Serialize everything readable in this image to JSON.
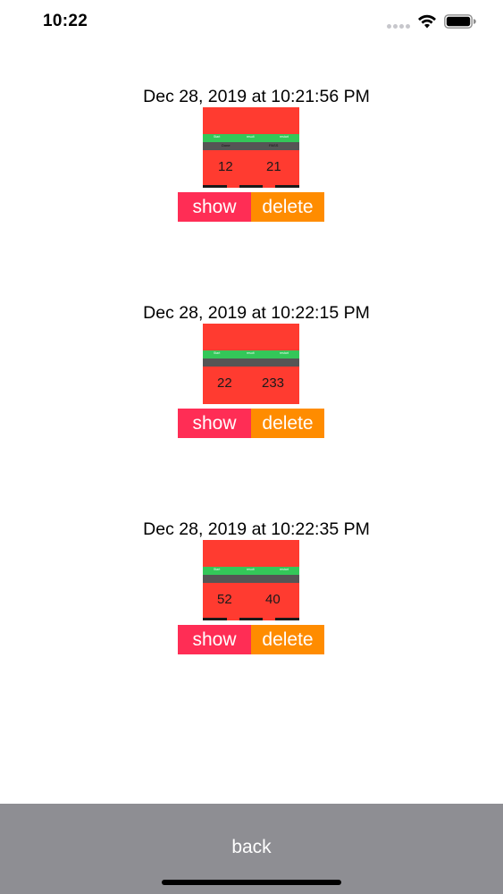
{
  "status_bar": {
    "time": "10:22"
  },
  "entries": [
    {
      "date": "Dec 28, 2019 at 10:21:56 PM",
      "thumbnail": {
        "header": [
          "Start",
          "result",
          "restart"
        ],
        "sub": [
          "Done",
          "PASS"
        ],
        "values": [
          "12",
          "21"
        ]
      },
      "show_label": "show",
      "delete_label": "delete"
    },
    {
      "date": "Dec 28, 2019 at 10:22:15 PM",
      "thumbnail": {
        "header": [
          "Start",
          "result",
          "restart"
        ],
        "sub": [
          "",
          ""
        ],
        "values": [
          "22",
          "233"
        ]
      },
      "show_label": "show",
      "delete_label": "delete"
    },
    {
      "date": "Dec 28, 2019 at 10:22:35 PM",
      "thumbnail": {
        "header": [
          "Start",
          "result",
          "restart"
        ],
        "sub": [
          "",
          ""
        ],
        "values": [
          "52",
          "40"
        ]
      },
      "show_label": "show",
      "delete_label": "delete"
    }
  ],
  "bottom_bar": {
    "back_label": "back"
  },
  "colors": {
    "thumbnail_bg": "#ff3b30",
    "thumbnail_header": "#34c759",
    "show_button": "#ff2d55",
    "delete_button": "#ff8c00",
    "bottom_bar": "#8e8e93"
  }
}
